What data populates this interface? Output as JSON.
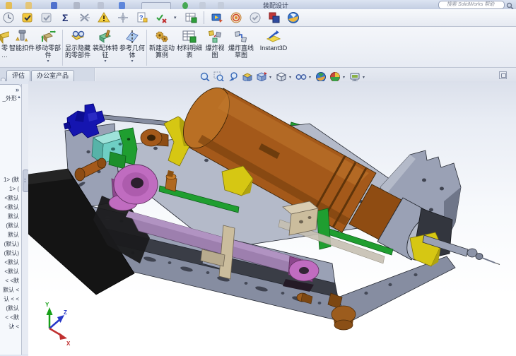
{
  "titlebar": {
    "title": "装配设计",
    "search_placeholder": "搜索 SolidWorks 帮助"
  },
  "glyphs": {
    "dropdown": "▾",
    "chevron": "»",
    "scroll_up": "▲",
    "scroll_down": "▾",
    "sigma": "Σ"
  },
  "toolbar_icons": [
    "design-binder",
    "design-checker-on",
    "design-checker-off",
    "equations",
    "no-external-references",
    "interference-detection",
    "align-components",
    "import-diagnostics",
    "verification",
    "design-table",
    "animation-wizard",
    "photoview-360",
    "task-complete",
    "compare-documents",
    "edrawings"
  ],
  "ribbon": {
    "buttons": [
      {
        "label": "零\n…",
        "dropdown": false
      },
      {
        "label": "智能扣件",
        "dropdown": false
      },
      {
        "label": "移动零部件",
        "dropdown": true
      },
      {
        "label": "显示隐藏的零部件",
        "dropdown": false
      },
      {
        "label": "装配体特征",
        "dropdown": true
      },
      {
        "label": "参考几何体",
        "dropdown": true
      },
      {
        "label": "新建运动算例",
        "dropdown": false
      },
      {
        "label": "材料明细表",
        "dropdown": false
      },
      {
        "label": "爆炸视图",
        "dropdown": false
      },
      {
        "label": "爆炸直线草图",
        "dropdown": false
      },
      {
        "label": "Instant3D",
        "dropdown": false
      }
    ]
  },
  "tabs": [
    {
      "label": "评估"
    },
    {
      "label": "办公室产品"
    }
  ],
  "viewport_toolbar": [
    "zoom-to-fit",
    "zoom-to-area",
    "previous-view",
    "section-view",
    "view-orientation",
    "display-style",
    "hide-show-items",
    "edit-appearance",
    "apply-scene",
    "view-settings"
  ],
  "sidebar": {
    "top_item": "_外形",
    "items": [
      "1> (默",
      "1> (",
      "<默认",
      "<默认",
      "默认",
      "(默认",
      "默认",
      "(默认)",
      "(默认)",
      "<默认",
      "<默认",
      "< <默",
      "默认 <",
      "认 < <",
      "(默认",
      "< <默",
      "认 <"
    ]
  },
  "triad": {
    "x": "X",
    "y": "Y",
    "z": "Z",
    "x_color": "#c03030",
    "y_color": "#18a018",
    "z_color": "#2838c8"
  },
  "model_palette": {
    "frame_light": "#b4bac9",
    "frame_mid": "#9aa1b5",
    "frame_dark": "#868da1",
    "frame_darker": "#6f7689",
    "motor_brown": "#a4591a",
    "motor_dark": "#7c430f",
    "motor_light": "#b96f24",
    "blue_part": "#1515b0",
    "teal_part": "#6ecfc4",
    "green_part": "#1f9e30",
    "yellow_part": "#d6c713",
    "magenta_part": "#c06cc0",
    "magenta_dark": "#8d478d",
    "belt_purple": "#9d7fae",
    "tan_part": "#cbbd9d",
    "knob_brown": "#9c5c1d",
    "black_part": "#141414"
  }
}
